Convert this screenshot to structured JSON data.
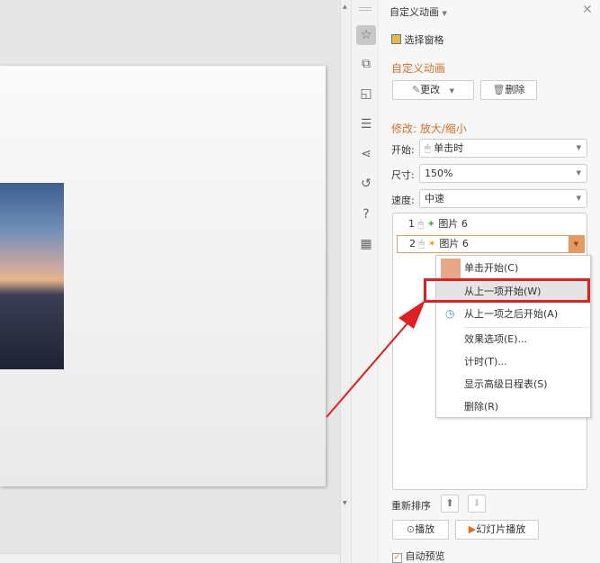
{
  "panel": {
    "title": "自定义动画",
    "select_pane": "选择窗格",
    "section_custom": "自定义动画",
    "change_button": "更改",
    "delete_button": "删除",
    "modify_heading": "修改: 放大/缩小",
    "start_label": "开始:",
    "start_value": "单击时",
    "size_label": "尺寸:",
    "size_value": "150%",
    "speed_label": "速度:",
    "speed_value": "中速",
    "items": [
      {
        "num": "1",
        "name": "图片 6"
      },
      {
        "num": "2",
        "name": "图片 6"
      }
    ],
    "reorder_label": "重新排序",
    "play_button": "播放",
    "slideshow_button": "幻灯片播放",
    "autopreview_label": "自动预览",
    "autopreview_checked": true
  },
  "menu": {
    "items": [
      "单击开始(C)",
      "从上一项开始(W)",
      "从上一项之后开始(A)",
      "效果选项(E)...",
      "计时(T)...",
      "显示高级日程表(S)",
      "删除(R)"
    ]
  },
  "colors": {
    "accent": "#d5702a",
    "highlight": "#e02020"
  }
}
